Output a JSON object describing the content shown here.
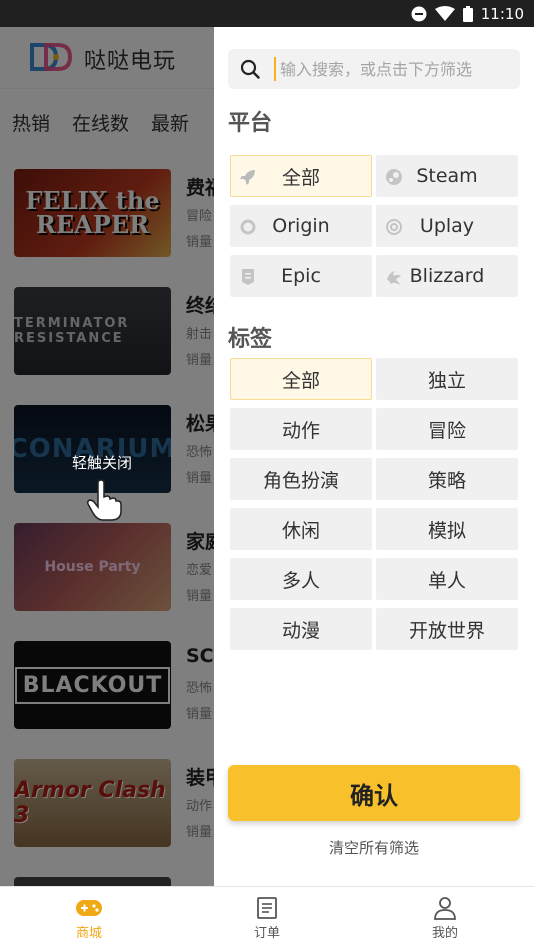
{
  "status_bar": {
    "time": "11:10"
  },
  "app": {
    "name": "哒哒电玩"
  },
  "sort_tabs": [
    "热销",
    "在线数",
    "最新"
  ],
  "games": [
    {
      "title": "费福",
      "tag": "冒险",
      "sales": "销量",
      "thumb_text": "FELIX the REAPER"
    },
    {
      "title": "终结",
      "tag": "射击",
      "sales": "销量",
      "thumb_text": "TERMINATOR RESISTANCE"
    },
    {
      "title": "松果",
      "tag": "恐怖",
      "sales": "销量",
      "thumb_text": "CONARIUM"
    },
    {
      "title": "家庭",
      "tag": "恋爱",
      "sales": "销量",
      "thumb_text": "House Party"
    },
    {
      "title": "SCP",
      "tag": "恐怖",
      "sales": "销量",
      "thumb_text": "BLACKOUT"
    },
    {
      "title": "装甲",
      "tag": "动作",
      "sales": "销量",
      "thumb_text": "Armor Clash 3"
    },
    {
      "title": "",
      "tag": "",
      "sales": "",
      "thumb_text": ""
    }
  ],
  "overlay": {
    "tap_to_close": "轻触关闭"
  },
  "filter": {
    "search_placeholder": "输入搜索，或点击下方筛选",
    "platform_title": "平台",
    "platforms": [
      {
        "label": "全部",
        "icon": "rocket-icon",
        "active": true
      },
      {
        "label": "Steam",
        "icon": "steam-icon",
        "active": false
      },
      {
        "label": "Origin",
        "icon": "origin-icon",
        "active": false
      },
      {
        "label": "Uplay",
        "icon": "uplay-icon",
        "active": false
      },
      {
        "label": "Epic",
        "icon": "epic-icon",
        "active": false
      },
      {
        "label": "Blizzard",
        "icon": "blizzard-icon",
        "active": false
      }
    ],
    "tags_title": "标签",
    "tags": [
      {
        "label": "全部",
        "active": true
      },
      {
        "label": "独立",
        "active": false
      },
      {
        "label": "动作",
        "active": false
      },
      {
        "label": "冒险",
        "active": false
      },
      {
        "label": "角色扮演",
        "active": false
      },
      {
        "label": "策略",
        "active": false
      },
      {
        "label": "休闲",
        "active": false
      },
      {
        "label": "模拟",
        "active": false
      },
      {
        "label": "多人",
        "active": false
      },
      {
        "label": "单人",
        "active": false
      },
      {
        "label": "动漫",
        "active": false
      },
      {
        "label": "开放世界",
        "active": false
      }
    ],
    "confirm_label": "确认",
    "clear_label": "清空所有筛选"
  },
  "bottom_nav": [
    {
      "label": "商城",
      "icon": "gamepad-icon",
      "active": true
    },
    {
      "label": "订单",
      "icon": "order-list-icon",
      "active": false
    },
    {
      "label": "我的",
      "icon": "user-icon",
      "active": false
    }
  ],
  "colors": {
    "accent": "#f8c12c",
    "active_bg": "#fff8e7",
    "nav_active": "#f0a814"
  }
}
